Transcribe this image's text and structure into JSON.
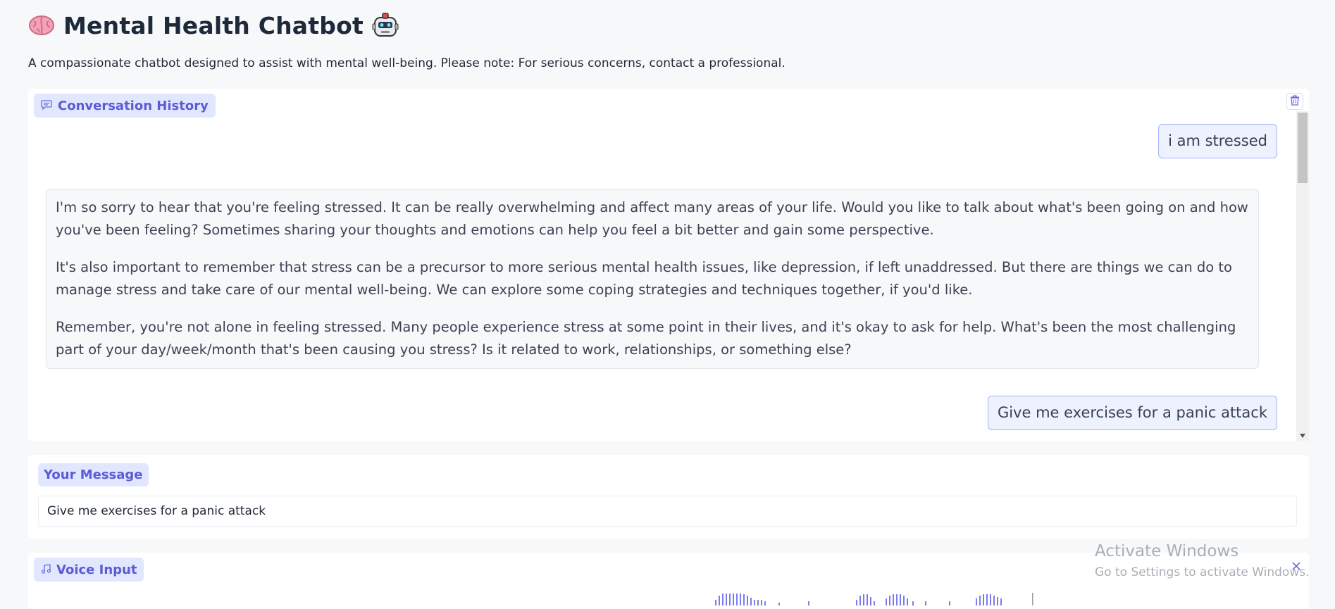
{
  "header": {
    "title": "Mental Health Chatbot",
    "subtitle": "A compassionate chatbot designed to assist with mental well-being. Please note: For serious concerns, contact a professional.",
    "leading_icon": "brain-emoji",
    "trailing_icon": "robot-emoji"
  },
  "conversation": {
    "label": "Conversation History",
    "label_icon": "chat-icon",
    "messages": [
      {
        "role": "user",
        "text": "i am stressed"
      },
      {
        "role": "bot",
        "paragraphs": [
          "I'm so sorry to hear that you're feeling stressed. It can be really overwhelming and affect many areas of your life. Would you like to talk about what's been going on and how you've been feeling? Sometimes sharing your thoughts and emotions can help you feel a bit better and gain some perspective.",
          "It's also important to remember that stress can be a precursor to more serious mental health issues, like depression, if left unaddressed. But there are things we can do to manage stress and take care of our mental well-being. We can explore some coping strategies and techniques together, if you'd like.",
          "Remember, you're not alone in feeling stressed. Many people experience stress at some point in their lives, and it's okay to ask for help. What's been the most challenging part of your day/week/month that's been causing you stress? Is it related to work, relationships, or something else?"
        ]
      },
      {
        "role": "user",
        "text": "Give me exercises for a panic attack"
      }
    ]
  },
  "message_input": {
    "label": "Your Message",
    "value": "Give me exercises for a panic attack"
  },
  "voice_input": {
    "label": "Voice Input",
    "label_icon": "music-note-icon"
  },
  "watermark": {
    "title": "Activate Windows",
    "subtitle": "Go to Settings to activate Windows."
  },
  "colors": {
    "accent": "#5b5bd6",
    "chip_bg": "#e0e7ff",
    "user_bubble_bg": "#eef2ff",
    "user_bubble_border": "#a5b4fc"
  }
}
